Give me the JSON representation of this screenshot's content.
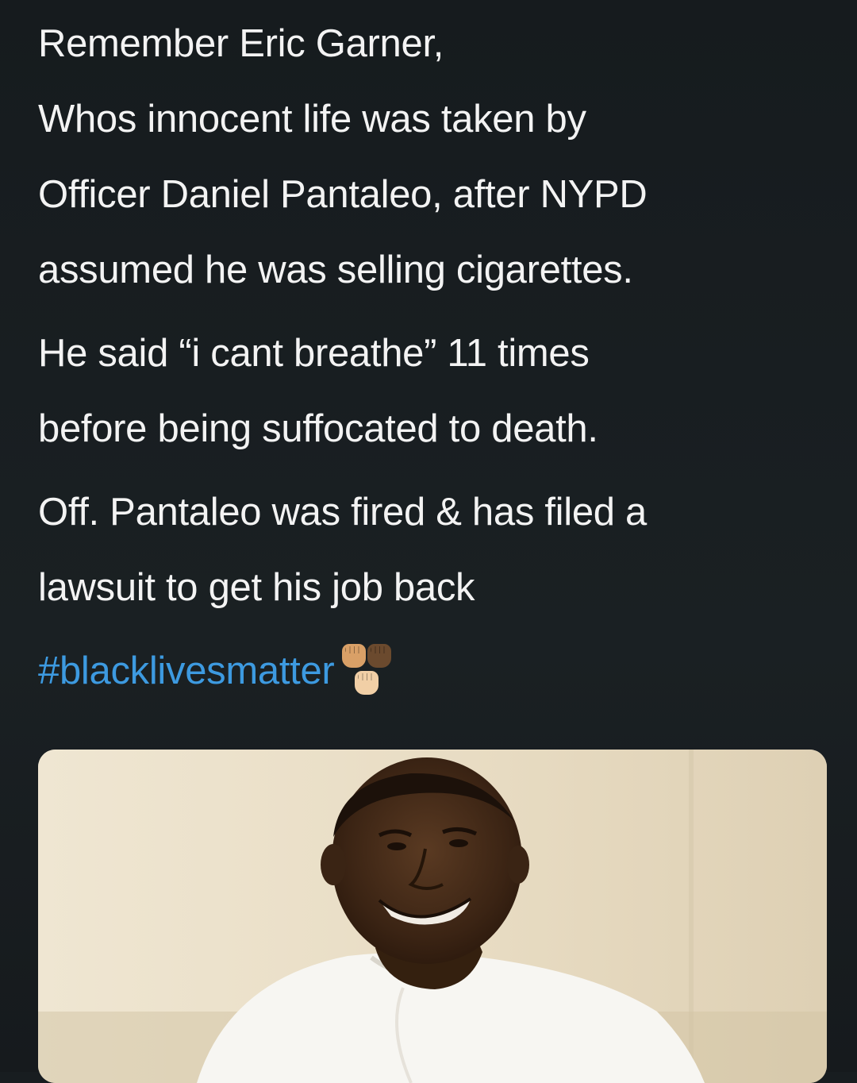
{
  "tweet": {
    "lines": [
      "Remember Eric Garner,",
      "Whos innocent life was taken by",
      "Officer Daniel Pantaleo, after NYPD",
      "assumed he was selling cigarettes.",
      "He said “i cant breathe” 11 times",
      "before being suffocated to death.",
      "Off. Pantaleo was fired & has filed a",
      "lawsuit to get his job back"
    ],
    "hashtag": "#blacklivesmatter",
    "emoji_icon": "raised-fists-icon"
  },
  "colors": {
    "background": "#181d20",
    "text": "#f3f3f3",
    "hashtag": "#3d9ae0"
  }
}
